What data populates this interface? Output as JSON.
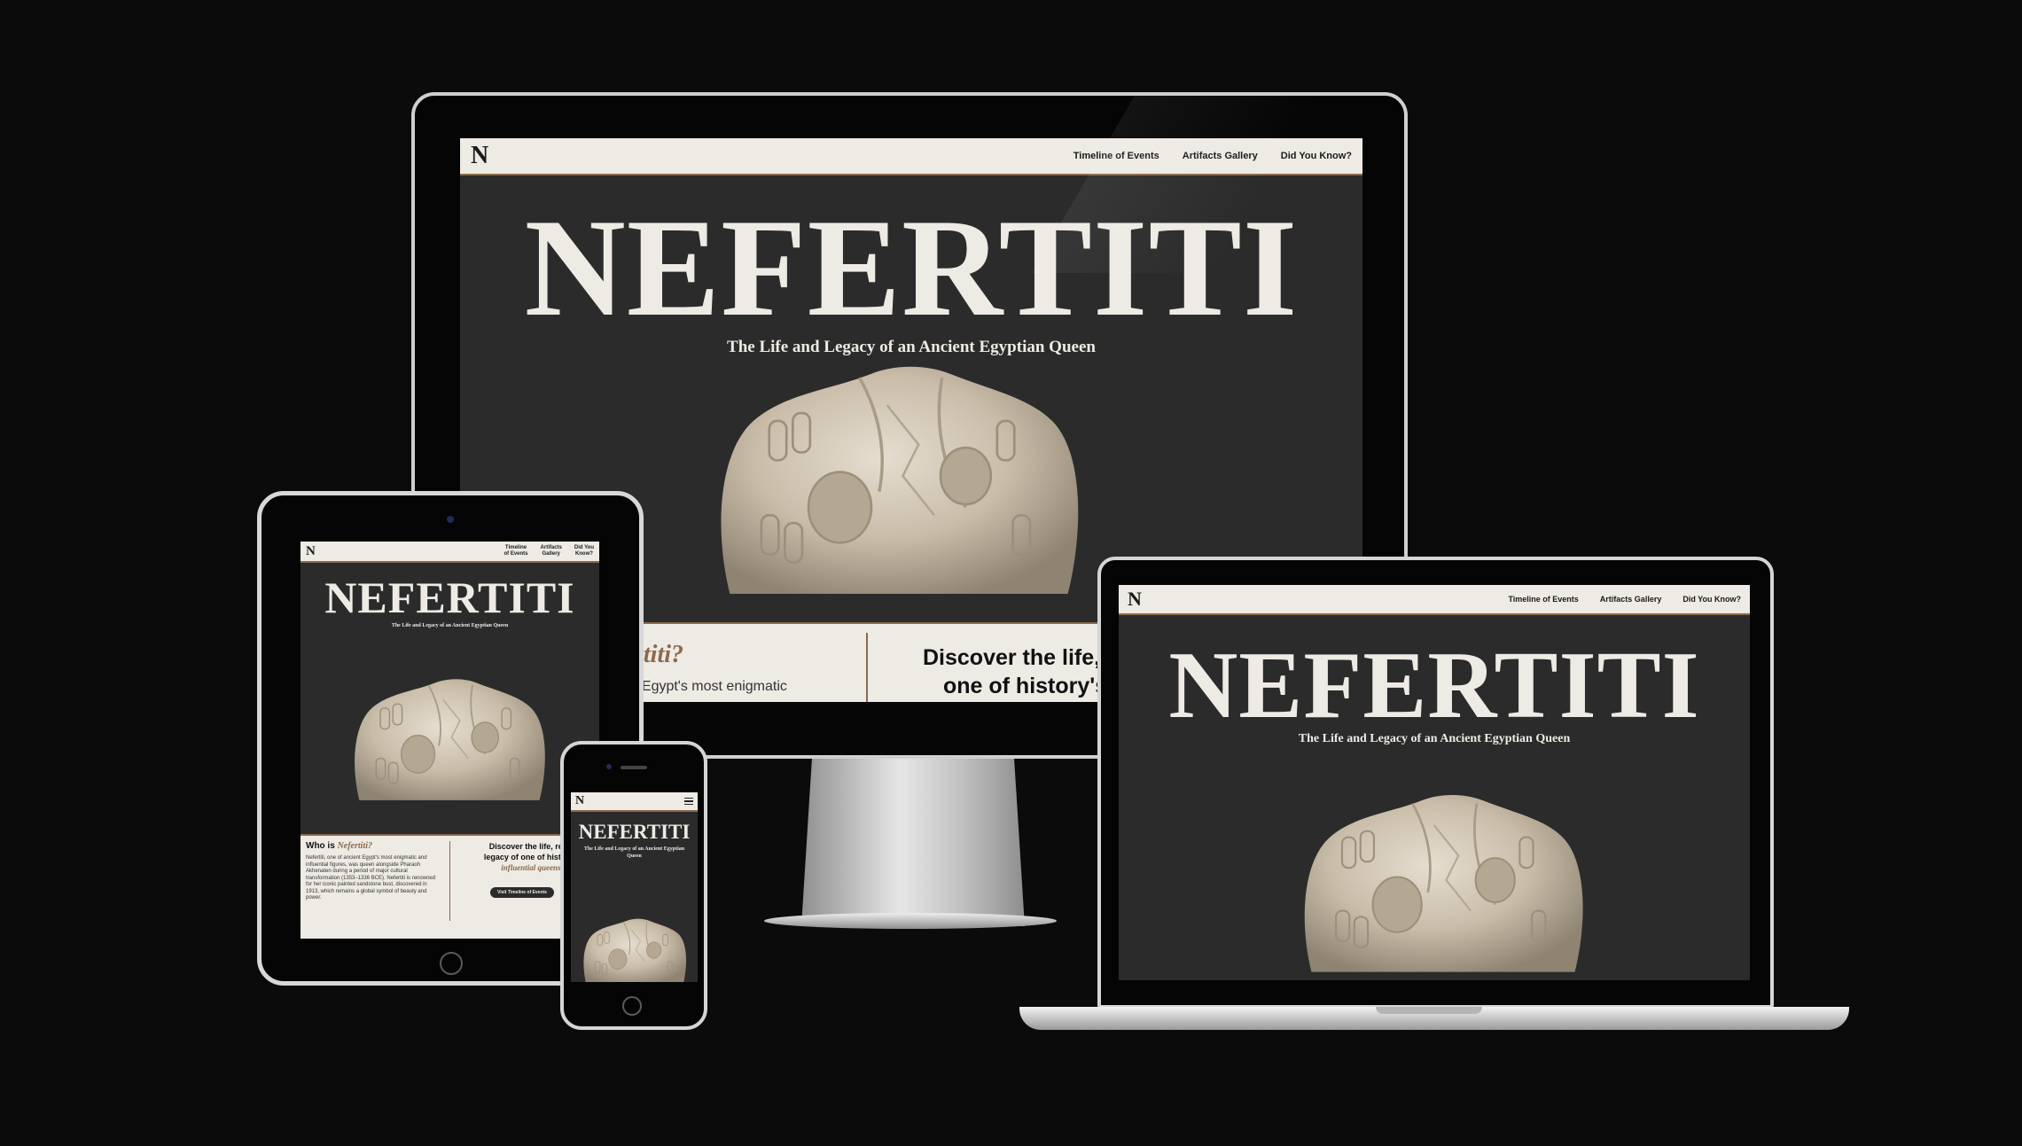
{
  "site": {
    "logo": "N",
    "nav_links": [
      "Timeline of Events",
      "Artifacts Gallery",
      "Did You Know?"
    ],
    "tablet_nav_links": [
      "Timeline\nof Events",
      "Artifacts\nGallery",
      "Did You\nKnow?"
    ],
    "title": "NEFERTITI",
    "subtitle": "The Life and Legacy of an Ancient Egyptian Queen",
    "about": {
      "heading_prefix": "Who is ",
      "heading_accent": "Nefertiti?",
      "heading_fragment": "rtiti?",
      "body": "Nefertiti, one of ancient Egypt's most enigmatic and influential figures, was queen alongside Pharaoh Akhenaten during a period of major cultural transformation (1353–1336 BCE). Nefertiti is renowned for her iconic painted sandstone bust, discovered in 1913, which remains a global symbol of beauty and power.",
      "body_fragment": "t Egypt's most enigmatic"
    },
    "discover": {
      "line1": "Discover the life, reign",
      "line2": "legacy of one of history's",
      "accent": "influential queens.",
      "desktop_line1": "Discover the life,",
      "desktop_line2": "one of history's",
      "button": "Visit Timeline of Events"
    }
  },
  "colors": {
    "background": "#0b0b0b",
    "page_dark": "#2b2b2b",
    "cream": "#eeeae4",
    "accent_brown": "#8b6a4a"
  },
  "icons": [
    "menu-icon",
    "home-button-icon",
    "camera-icon"
  ]
}
